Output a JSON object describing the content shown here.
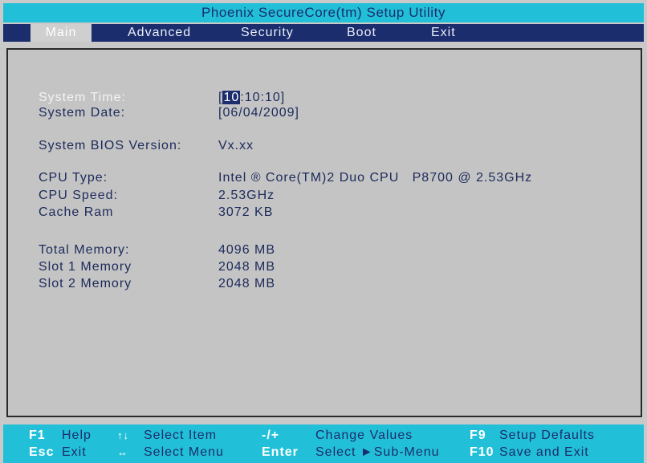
{
  "title": "Phoenix SecureCore(tm) Setup Utility",
  "menu": {
    "main": "Main",
    "advanced": "Advanced",
    "security": "Security",
    "boot": "Boot",
    "exit": "Exit"
  },
  "main": {
    "system_time": {
      "label": "System Time:",
      "open": "[",
      "hour": "10",
      "rest": ":10:10]"
    },
    "system_date": {
      "label": "System Date:",
      "value": "[06/04/2009]"
    },
    "bios_version": {
      "label": "System BIOS Version:",
      "value": "Vx.xx"
    },
    "cpu_type": {
      "label": "CPU Type:",
      "value": "Intel ® Core(TM)2 Duo CPU   P8700 @ 2.53GHz"
    },
    "cpu_speed": {
      "label": "CPU Speed:",
      "value": "2.53GHz"
    },
    "cache_ram": {
      "label": "Cache Ram",
      "value": "3072 KB"
    },
    "total_memory": {
      "label": "Total Memory:",
      "value": "4096 MB"
    },
    "slot1_memory": {
      "label": "Slot 1 Memory",
      "value": "2048 MB"
    },
    "slot2_memory": {
      "label": "Slot 2 Memory",
      "value": "2048 MB"
    }
  },
  "footer": {
    "row1": {
      "k1": "F1",
      "t1": "Help",
      "k2": "↑↓",
      "t2": "Select Item",
      "k3": "-/+",
      "t3": "Change Values",
      "k4": "F9",
      "t4": "Setup Defaults"
    },
    "row2": {
      "k1": "Esc",
      "t1": "Exit",
      "k2": "↔",
      "t2": "Select Menu",
      "k3": "Enter",
      "t3": "Select ►Sub-Menu",
      "k4": "F10",
      "t4": "Save and Exit"
    }
  },
  "colors": {
    "title_bar": "#22c0d8",
    "menu_bar": "#1c2d6e",
    "content_bg": "#c4c4c4",
    "text": "#1c2a5a",
    "highlight": "#1c2d6e"
  }
}
